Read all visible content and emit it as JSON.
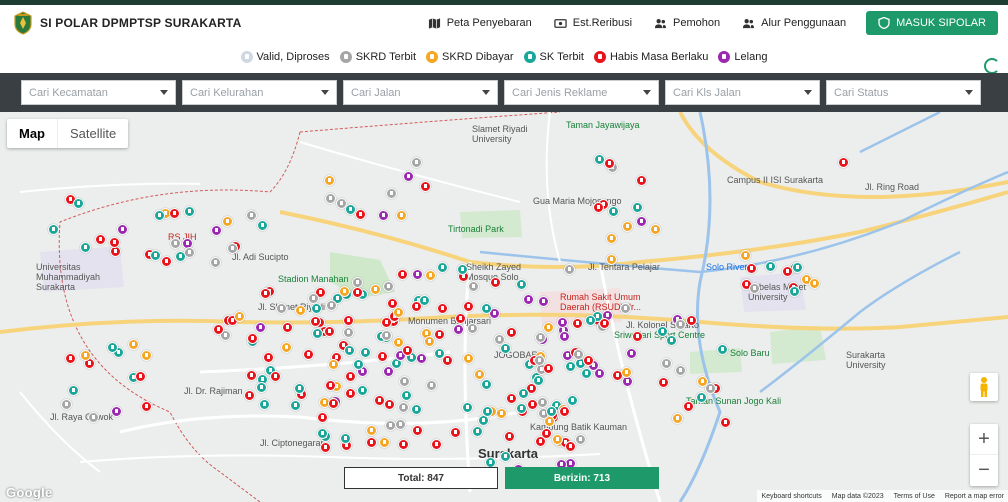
{
  "header": {
    "brand_title": "SI POLAR DPMPTSP SURAKARTA",
    "nav": [
      {
        "label": "Peta Penyebaran",
        "icon": "map-icon"
      },
      {
        "label": "Est.Reribusi",
        "icon": "money-icon"
      },
      {
        "label": "Pemohon",
        "icon": "users-icon"
      },
      {
        "label": "Alur Penggunaan",
        "icon": "users-icon"
      }
    ],
    "cta_label": "MASUK SIPOLAR",
    "accent": "#1e9a6a"
  },
  "legend": [
    {
      "label": "Valid, Diproses",
      "color": "#ffffff"
    },
    {
      "label": "SKRD Terbit",
      "color": "#a6a6a6"
    },
    {
      "label": "SKRD Dibayar",
      "color": "#f5a623"
    },
    {
      "label": "SK Terbit",
      "color": "#1aa79a"
    },
    {
      "label": "Habis Masa Berlaku",
      "color": "#e8141b"
    },
    {
      "label": "Lelang",
      "color": "#9c27b0"
    }
  ],
  "filters": [
    {
      "placeholder": "Cari Kecamatan"
    },
    {
      "placeholder": "Cari Kelurahan"
    },
    {
      "placeholder": "Cari Jalan"
    },
    {
      "placeholder": "Cari Jenis Reklame"
    },
    {
      "placeholder": "Cari Kls Jalan"
    },
    {
      "placeholder": "Cari Status"
    }
  ],
  "map": {
    "type_map": "Map",
    "type_satellite": "Satellite",
    "zoom_in": "+",
    "zoom_out": "−",
    "google_label": "Google",
    "labels": {
      "slamet_riyadi": "Slamet Riyadi University",
      "taman_jaya": "Taman Jayawijaya",
      "campus_isi": "Campus II ISI Surakarta",
      "ring_road": "Jl. Ring Road",
      "gua_maria": "Gua Maria Mojosongo",
      "tirtonadi": "Tirtonadi Park",
      "sheikh_zayed": "Sheikh Zayed Mosque Solo",
      "ums": "Universitas Muhammadiyah Surakarta",
      "stadion": "Stadion Manahan",
      "rs_jih": "RS JIH",
      "rs_moewardi": "Rumah Sakit Umum Daerah (RSUD) dr...",
      "sebelas_maret": "Sebelas Maret University",
      "solo_river": "Solo River",
      "monumen": "Monumen Banjarsari",
      "sport_centre": "Sriwedari Sport Centre",
      "surakarta_univ": "Surakarta University",
      "taman_sunan": "Taman Sunan Jogo Kali",
      "kampung_kauman": "Kampung Batik Kauman",
      "surakarta": "Surakarta",
      "jl_slamet": "Jl. Slamet Riyadi",
      "jl_kolonel": "Jl. Kolonel Sutarto",
      "jl_tentara": "Jl. Tentara Pelajar",
      "jl_adi": "Jl. Adi Sucipto",
      "jl_dr_radjiman": "Jl. Dr. Rajiman",
      "jl_ciptonegaran": "Jl. Ciptonegaran",
      "gajah": "Jl. Raya Gawok",
      "solo_ring": "Solo Baru",
      "jogobaru": "JOGOBARU"
    }
  },
  "counters": {
    "total": "Total: 847",
    "berizin": "Berizin: 713"
  },
  "attribution": {
    "shortcuts": "Keyboard shortcuts",
    "data": "Map data ©2023",
    "terms": "Terms of Use",
    "report": "Report a map error"
  }
}
